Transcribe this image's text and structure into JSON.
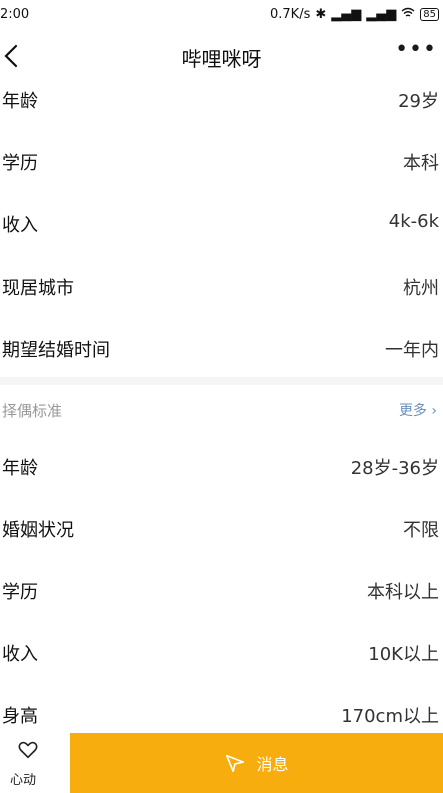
{
  "status": {
    "time": "2:00",
    "network_speed": "0.7K/s",
    "battery": "85"
  },
  "nav": {
    "title": "哔哩咪呀"
  },
  "profile": [
    {
      "label": "年龄",
      "value": "29岁"
    },
    {
      "label": "学历",
      "value": "本科"
    },
    {
      "label": "收入",
      "value": "4k-6k"
    },
    {
      "label": "现居城市",
      "value": "杭州"
    },
    {
      "label": "期望结婚时间",
      "value": "一年内"
    }
  ],
  "criteria": {
    "title": "择偶标准",
    "more": "更多",
    "items": [
      {
        "label": "年龄",
        "value": "28岁-36岁"
      },
      {
        "label": "婚姻状况",
        "value": "不限"
      },
      {
        "label": "学历",
        "value": "本科以上"
      },
      {
        "label": "收入",
        "value": "10K以上"
      },
      {
        "label": "身高",
        "value": "170cm以上"
      }
    ]
  },
  "bottom": {
    "heart_label": "心动",
    "message_label": "消息",
    "accent_color": "#f8ad0f"
  }
}
